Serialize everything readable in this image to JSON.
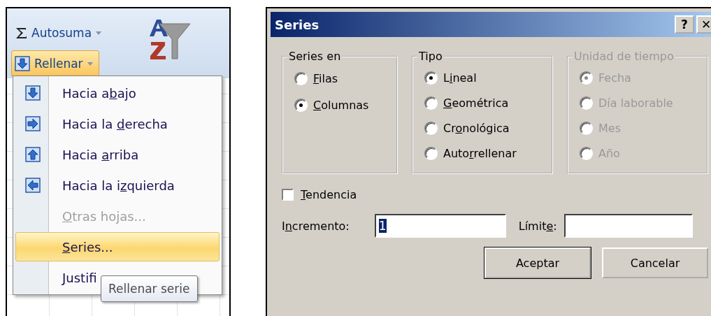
{
  "ribbon": {
    "buttons": [
      {
        "kind": "sum",
        "label": "Autosuma",
        "highlighted": false
      },
      {
        "kind": "fill",
        "label": "Rellenar",
        "highlighted": true
      }
    ]
  },
  "menu": {
    "items": [
      {
        "kind": "down",
        "label": {
          "before": "Hacia a",
          "key": "b",
          "after": "ajo"
        },
        "disabled": false,
        "selected": false
      },
      {
        "kind": "right",
        "label": {
          "before": "Hacia la ",
          "key": "d",
          "after": "erecha"
        },
        "disabled": false,
        "selected": false
      },
      {
        "kind": "up",
        "label": {
          "before": "Hacia ",
          "key": "a",
          "after": "rriba"
        },
        "disabled": false,
        "selected": false
      },
      {
        "kind": "left",
        "label": {
          "before": "Hacia la i",
          "key": "z",
          "after": "quierda"
        },
        "disabled": false,
        "selected": false
      },
      {
        "kind": "plain",
        "label": {
          "key": "O",
          "after": "tras hojas..."
        },
        "disabled": true,
        "selected": false
      },
      {
        "kind": "plain",
        "label": {
          "key": "S",
          "after": "eries..."
        },
        "disabled": false,
        "selected": true
      },
      {
        "kind": "plain",
        "label": {
          "key": "J",
          "after": "ustifi"
        },
        "disabled": false,
        "selected": false
      }
    ]
  },
  "tooltip": {
    "text": "Rellenar serie"
  },
  "dialog": {
    "title": "Series",
    "title_buttons": [
      "?",
      "✕"
    ],
    "groups": [
      {
        "title": "Series en",
        "disabled": false,
        "options": [
          {
            "label": {
              "key": "F",
              "after": "ilas"
            },
            "selected": false
          },
          {
            "label": {
              "key": "C",
              "after": "olumnas"
            },
            "selected": true
          }
        ]
      },
      {
        "title": "Tipo",
        "disabled": false,
        "options": [
          {
            "label": {
              "before": "L",
              "key": "i",
              "after": "neal"
            },
            "selected": true
          },
          {
            "label": {
              "key": "G",
              "after": "eométrica"
            },
            "selected": false
          },
          {
            "label": {
              "before": "Cr",
              "key": "o",
              "after": "nológica"
            },
            "selected": false
          },
          {
            "label": {
              "before": "Auto",
              "key": "r",
              "after": "rellenar"
            },
            "selected": false
          }
        ]
      },
      {
        "title": "Unidad de tiempo",
        "disabled": true,
        "options": [
          {
            "label": {
              "before": "Fecha"
            },
            "selected": true
          },
          {
            "label": {
              "before": "Día laborable"
            },
            "selected": false
          },
          {
            "label": {
              "before": "Mes"
            },
            "selected": false
          },
          {
            "label": {
              "before": "Año"
            },
            "selected": false
          }
        ]
      }
    ],
    "trend": {
      "label": {
        "key": "T",
        "after": "endencia"
      },
      "checked": false
    },
    "fields": [
      {
        "label": {
          "before": "I",
          "key": "n",
          "after": "cremento:"
        },
        "value": "1",
        "value_selected": true
      },
      {
        "label": {
          "before": "Límit",
          "key": "e",
          "after": ":"
        }
      }
    ],
    "buttons": [
      {
        "label": "Aceptar",
        "default": true
      },
      {
        "label": "Cancelar",
        "default": false
      }
    ]
  }
}
